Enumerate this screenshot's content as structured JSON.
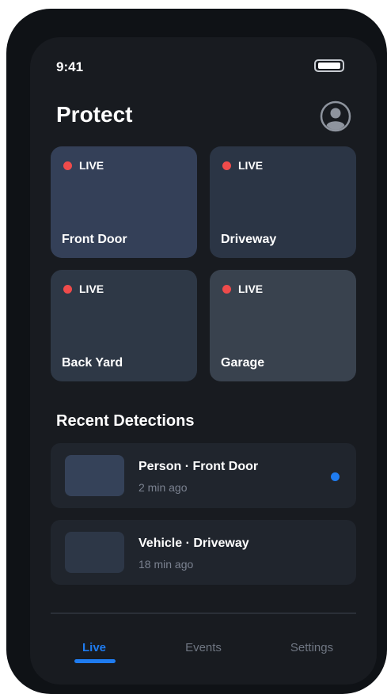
{
  "status_bar": {
    "time": "9:41"
  },
  "header": {
    "title": "Protect",
    "profile_icon": "user-circle-icon"
  },
  "cameras": [
    {
      "name": "Front Door",
      "live_label": "LIVE",
      "bg": "#344058"
    },
    {
      "name": "Driveway",
      "live_label": "LIVE",
      "bg": "#2b3545"
    },
    {
      "name": "Back Yard",
      "live_label": "LIVE",
      "bg": "#2e3846"
    },
    {
      "name": "Garage",
      "live_label": "LIVE",
      "bg": "#39424e"
    }
  ],
  "recent": {
    "title": "Recent Detections",
    "items": [
      {
        "title": "Person · Front Door",
        "time": "2 min ago",
        "unread": true,
        "thumb_color": "#354259"
      },
      {
        "title": "Vehicle · Driveway",
        "time": "18 min ago",
        "unread": false,
        "thumb_color": "#2d3747"
      }
    ]
  },
  "tabs": [
    {
      "label": "Live",
      "active": true
    },
    {
      "label": "Events",
      "active": false
    },
    {
      "label": "Settings",
      "active": false
    }
  ],
  "colors": {
    "live_dot": "#ef4b4b",
    "accent": "#1f7cf0"
  }
}
